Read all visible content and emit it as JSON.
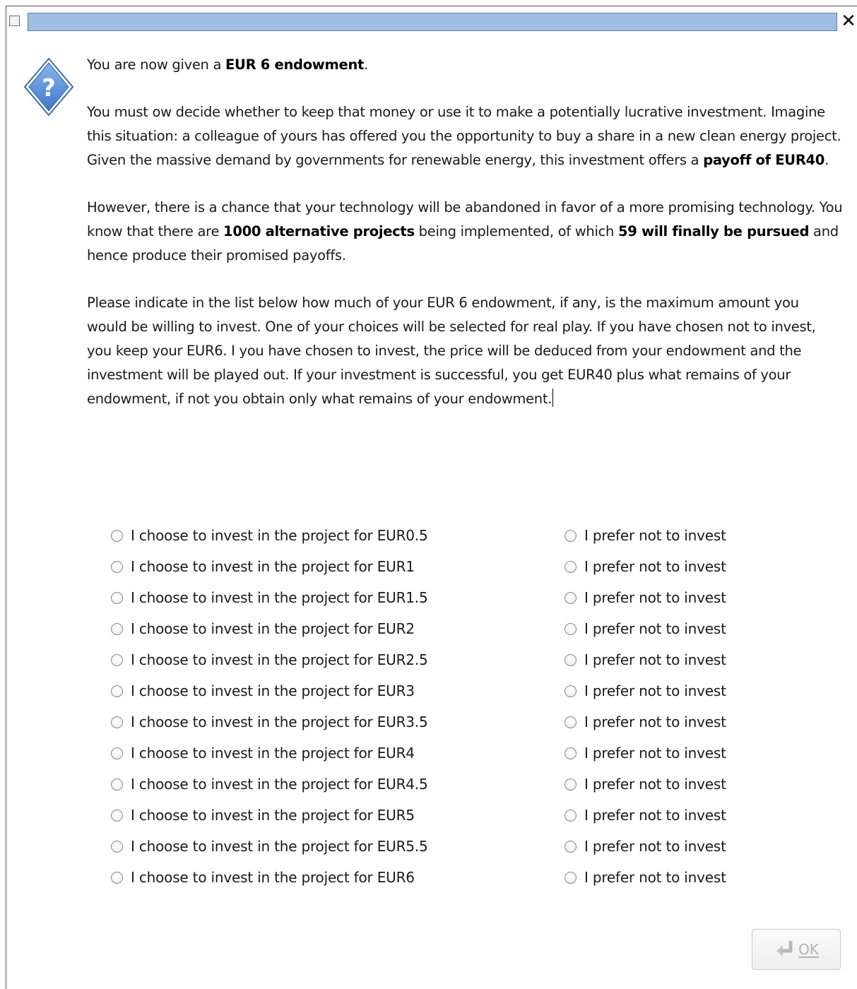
{
  "window": {
    "close_glyph": "✕",
    "title": ""
  },
  "message": {
    "p1_pre": "You are now given a ",
    "p1_bold": "EUR 6 endowment",
    "p1_post": ".",
    "p2_text": "You must ow decide whether to keep that money or use it to make a potentially lucrative investment. Imagine this situation: a colleague of yours has offered you the opportunity to buy a share in a new clean energy project. Given the massive demand by governments for renewable energy, this investment offers a ",
    "p2_bold": "payoff of EUR40",
    "p2_post": ".",
    "p3_pre": "However, there is a chance that your technology will be abandoned in favor of a more promising technology. You know that there are ",
    "p3_bold1": "1000 alternative projects",
    "p3_mid": " being implemented, of which ",
    "p3_bold2": "59 will finally be pursued",
    "p3_post": " and hence produce their promised payoffs.",
    "p4_text": "Please indicate in the list below how much of your EUR 6 endowment, if any, is the maximum amount you would be willing to invest. One of your choices will be selected for real play. If you have chosen not to invest, you keep your EUR6. I you have chosen to invest, the price will be deduced from your endowment and the investment will be played out. If your investment is successful, you get EUR40 plus what remains of your endowment, if not you obtain only what remains of your endowment."
  },
  "choices": [
    {
      "invest_label": "I choose to invest in the project for EUR0.5",
      "decline_label": "I prefer not to invest"
    },
    {
      "invest_label": "I choose to invest in the project for EUR1",
      "decline_label": "I prefer not to invest"
    },
    {
      "invest_label": "I choose to invest in the project for EUR1.5",
      "decline_label": "I prefer not to invest"
    },
    {
      "invest_label": "I choose to invest in the project for EUR2",
      "decline_label": "I prefer not to invest"
    },
    {
      "invest_label": "I choose to invest in the project for EUR2.5",
      "decline_label": "I prefer not to invest"
    },
    {
      "invest_label": "I choose to invest in the project for EUR3",
      "decline_label": "I prefer not to invest"
    },
    {
      "invest_label": "I choose to invest in the project for EUR3.5",
      "decline_label": "I prefer not to invest"
    },
    {
      "invest_label": "I choose to invest in the project for EUR4",
      "decline_label": "I prefer not to invest"
    },
    {
      "invest_label": "I choose to invest in the project for EUR4.5",
      "decline_label": "I prefer not to invest"
    },
    {
      "invest_label": "I choose to invest in the project for EUR5",
      "decline_label": "I prefer not to invest"
    },
    {
      "invest_label": "I choose to invest in the project for EUR5.5",
      "decline_label": "I prefer not to invest"
    },
    {
      "invest_label": "I choose to invest in the project for EUR6",
      "decline_label": "I prefer not to invest"
    }
  ],
  "ok_button": {
    "label": "OK",
    "enabled": false
  },
  "icons": {
    "dialog_icon": "question-icon",
    "ok_icon": "enter-arrow-icon"
  },
  "colors": {
    "title_strip": "#a9c3e6",
    "question_icon": "#5b8fd6",
    "disabled_text": "#b3b3b3"
  }
}
